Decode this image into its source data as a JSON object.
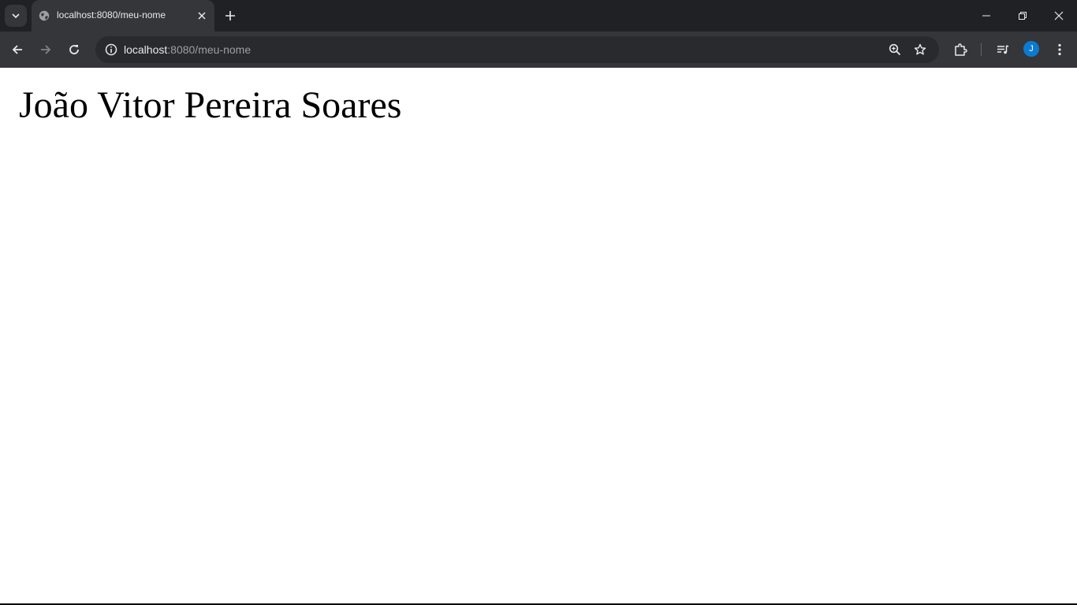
{
  "tab": {
    "title": "localhost:8080/meu-nome",
    "favicon_icon": "globe-icon",
    "close_icon": "close-icon"
  },
  "tabstrip": {
    "tab_list_icon": "chevron-down-icon",
    "new_tab_icon": "plus-icon"
  },
  "window_controls": [
    "minimize-icon",
    "restore-icon",
    "close-icon"
  ],
  "toolbar": {
    "back_icon": "arrow-left-icon",
    "forward_icon": "arrow-right-icon",
    "reload_icon": "reload-icon",
    "omnibox": {
      "site_info_icon": "info-icon",
      "url_host": "localhost",
      "url_path": ":8080/meu-nome",
      "zoom_icon": "zoom-in-icon",
      "bookmark_icon": "star-icon"
    },
    "extensions_icon": "puzzle-icon",
    "media_icon": "media-queue-icon",
    "profile_initial": "J",
    "menu_icon": "kebab-menu-icon"
  },
  "page": {
    "heading": "João Vitor Pereira Soares"
  },
  "colors": {
    "chrome_dark": "#202124",
    "toolbar": "#35363a",
    "omnibox": "#292a2d",
    "avatar": "#0b7bd1",
    "page_bg": "#ffffff"
  }
}
